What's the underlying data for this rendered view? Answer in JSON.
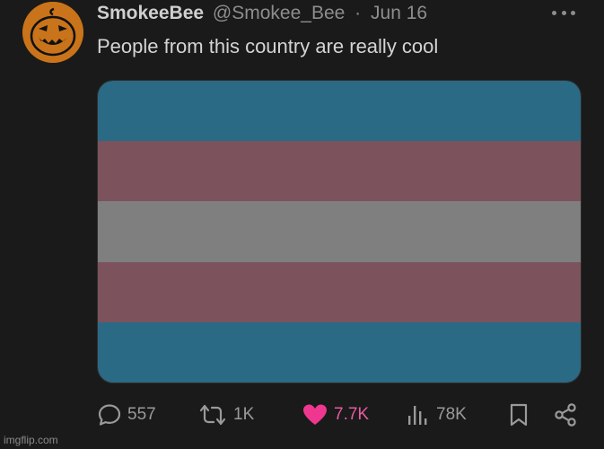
{
  "post": {
    "display_name": "SmokeeBee",
    "handle": "@Smokee_Bee",
    "separator": "·",
    "date": "Jun 16",
    "text": "People from this country are really cool",
    "avatar_icon": "jack-o-lantern-icon"
  },
  "media": {
    "type": "flag",
    "stripes": [
      "#2a6a85",
      "#7c525c",
      "#7f7f7f",
      "#7c525c",
      "#2a6a85"
    ]
  },
  "actions": {
    "replies": "557",
    "reposts": "1K",
    "likes": "7.7K",
    "views": "78K"
  },
  "colors": {
    "background": "#1a1a1a",
    "like_accent": "#e65ba1",
    "muted": "#8d8d8d"
  },
  "watermark": "imgflip.com"
}
